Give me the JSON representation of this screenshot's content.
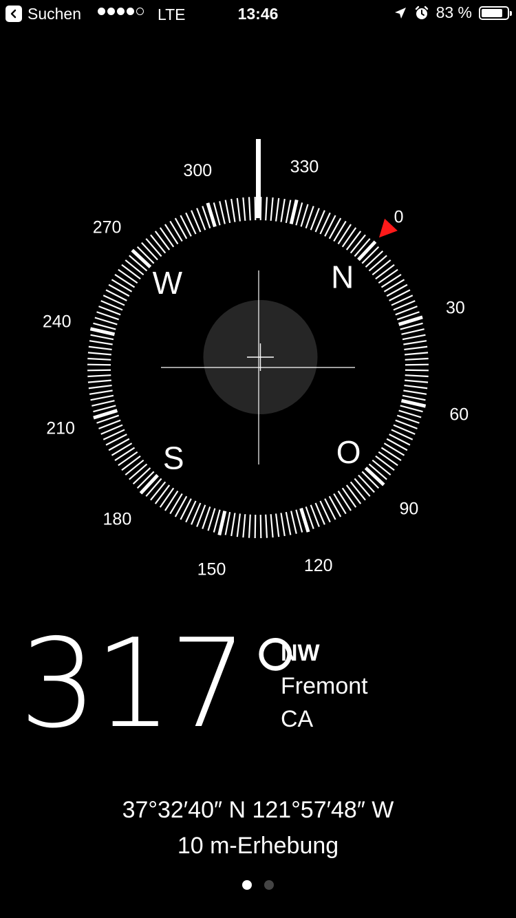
{
  "status_bar": {
    "back_label": "Suchen",
    "carrier": "LTE",
    "time": "13:46",
    "battery_text": "83 %",
    "battery_level": 0.83
  },
  "compass": {
    "heading": 317,
    "degree_labels": [
      "0",
      "30",
      "60",
      "90",
      "120",
      "150",
      "180",
      "210",
      "240",
      "270",
      "300",
      "330"
    ],
    "cardinal_labels": {
      "north": "N",
      "east": "O",
      "south": "S",
      "west": "W"
    },
    "indicator_color": "#ff1a1a"
  },
  "readout": {
    "heading_value": "317°",
    "direction": "NW",
    "city": "Fremont",
    "region": "CA",
    "coordinates": "37°32′40″ N  121°57′48″ W",
    "elevation": "10 m-Erhebung"
  },
  "pager": {
    "total": 2,
    "active": 0
  }
}
